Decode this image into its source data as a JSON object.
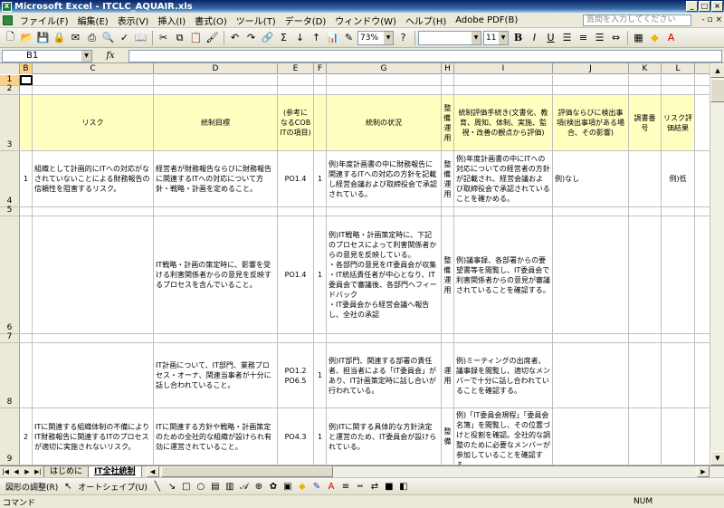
{
  "window": {
    "title": "Microsoft Excel - ITCLC_AQUAIR.xls",
    "min": "_",
    "max": "□",
    "close": "×"
  },
  "menu": {
    "items": [
      "ファイル(F)",
      "編集(E)",
      "表示(V)",
      "挿入(I)",
      "書式(O)",
      "ツール(T)",
      "データ(D)",
      "ウィンドウ(W)",
      "ヘルプ(H)",
      "Adobe PDF(B)"
    ],
    "help_placeholder": "質問を入力してください",
    "doc_controls": "- ▫ ×"
  },
  "toolbar": {
    "zoom": "73%",
    "font_size": "11",
    "bold": "B",
    "italic": "I",
    "underline": "U"
  },
  "formula_bar": {
    "name_box": "B1",
    "fx": "fx",
    "value": ""
  },
  "columns": [
    {
      "id": "B",
      "sel": true
    },
    {
      "id": "C"
    },
    {
      "id": "D"
    },
    {
      "id": "E"
    },
    {
      "id": "F"
    },
    {
      "id": "G"
    },
    {
      "id": "H"
    },
    {
      "id": "I"
    },
    {
      "id": "J"
    },
    {
      "id": "K"
    },
    {
      "id": "L"
    }
  ],
  "rows": {
    "r1": "1",
    "r2": "2",
    "r3": "3",
    "r4": "4",
    "r5": "5",
    "r6": "6",
    "r7": "7",
    "r8": "8",
    "r9": "9"
  },
  "header_row": {
    "C": "リスク",
    "D": "統制目標",
    "E": "(参考になるCOBITの項目)",
    "G": "統制の状況",
    "H": "整備・運用",
    "I": "統制評価手続き(文書化、教育、周知、体制、実施、監視・改善の観点から評価)",
    "J": "評価ならびに検出事項(検出事項がある場合、その影響)",
    "K": "調書番号",
    "L": "リスク評価結果"
  },
  "row4": {
    "B": "1",
    "C": "組織として計画的にITへの対応がなされていないことによる財務報告の信頼性を阻害するリスク。",
    "D": "経営者が財務報告ならびに財務報告に関連するITへの対応について方針・戦略・計画を定めること。",
    "E": "PO1.4",
    "F": "1",
    "G": "例)年度計画書の中に財務報告に関連するITへの対応の方針を記載し経営会議および取締役会で承認されている。",
    "H": "整備・運用",
    "I": "例)年度計画書の中にITへの対応についての経営者の方針が記載され、経営会議および取締役会で承認されていることを確かめる。",
    "J": "例)なし",
    "L": "例)低"
  },
  "row6": {
    "D": "IT戦略・計画の策定時に、影響を受ける利害関係者からの意見を反映するプロセスを含んでいること。",
    "E": "PO1.4",
    "F": "1",
    "G": "例)IT戦略・計画策定時に、下記のプロセスによって利害関係者からの意見を反映している。\n・各部門の意見をIT委員会が収集\n・IT統括責任者が中心となり、IT委員会で審議後、各部門へフィードバック\n・IT委員会から経営会議へ報告し、全社の承認",
    "H": "整備・運用",
    "I": "例)議事録、各部署からの要望書等を閲覧し、IT委員会で利害関係者からの意見が審議されていることを確認する。"
  },
  "row8": {
    "D": "IT計画について、IT部門、業務プロセス・オーナ、関連当事者が十分に話し合われていること。",
    "E": "PO1.2\nPO6.5",
    "F": "1",
    "G": "例)IT部門、関連する部署の責任者、担当者による「IT委員会」があり、IT計画策定時に話し合いが行われている。",
    "H": "運用",
    "I": "例)ミーティングの出席者、議事録を閲覧し、適切なメンバーで十分に話し合われていることを確認する。"
  },
  "row9": {
    "B": "2",
    "C": "ITに関連する組織体制の不備によりIT財務報告に関連するITのプロセスが適切に実施されないリスク。",
    "D": "ITに関連する方針や戦略・計画策定のための全社的な組織が設けられ有効に運営されていること。",
    "E": "PO4.3",
    "F": "1",
    "G": "例)ITに関する具体的な方針決定と運営のため、IT委員会が設けられている。",
    "H": "整備",
    "I": "例)「IT委員会規程」「委員会名簿」を閲覧し、その位置づけと役割を確認。全社的な調整のために必要なメンバーが参加していることを確認する。"
  },
  "sheet_tabs": {
    "tab1": "はじめに",
    "tab2": "IT全社統制"
  },
  "drawbar": {
    "draw": "図形の調整(R)",
    "autoshape": "オートシェイプ(U)"
  },
  "status": {
    "mode": "コマンド",
    "num": "NUM"
  }
}
